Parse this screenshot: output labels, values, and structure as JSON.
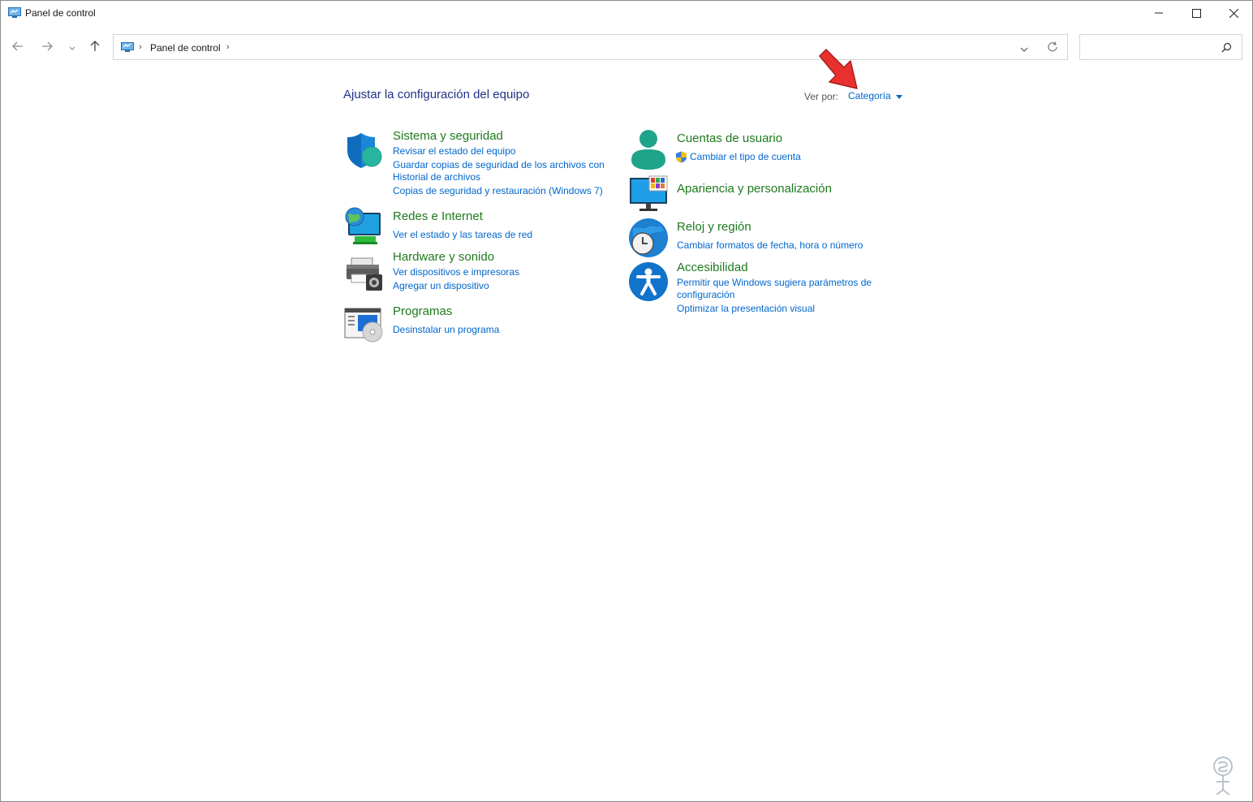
{
  "window": {
    "title": "Panel de control",
    "controls": [
      "minimize-icon",
      "maximize-icon",
      "close-icon"
    ]
  },
  "nav": {
    "back": "back-arrow-icon",
    "forward": "forward-arrow-icon",
    "recent": "chevron-down-icon",
    "up": "up-arrow-icon"
  },
  "address": {
    "separator": "›",
    "crumb": "Panel de control"
  },
  "search": {
    "placeholder": ""
  },
  "content": {
    "title": "Ajustar la configuración del equipo",
    "view_by_label": "Ver por:",
    "view_by_value": "Categoría"
  },
  "categories": {
    "left": [
      {
        "title": "Sistema y seguridad",
        "icon": "shield-icon",
        "links": [
          "Revisar el estado del equipo",
          "Guardar copias de seguridad de los archivos con",
          "Historial de archivos",
          "Copias de seguridad y restauración (Windows 7)"
        ]
      },
      {
        "title": "Redes e Internet",
        "icon": "network-globe-icon",
        "links": [
          "Ver el estado y las tareas de red"
        ]
      },
      {
        "title": "Hardware y sonido",
        "icon": "printer-icon",
        "links": [
          "Ver dispositivos e impresoras",
          "Agregar un dispositivo"
        ]
      },
      {
        "title": "Programas",
        "icon": "programs-icon",
        "links": [
          "Desinstalar un programa"
        ]
      }
    ],
    "right": [
      {
        "title": "Cuentas de usuario",
        "icon": "user-icon",
        "links": [
          "Cambiar el tipo de cuenta"
        ]
      },
      {
        "title": "Apariencia y personalización",
        "icon": "monitor-icon",
        "links": []
      },
      {
        "title": "Reloj y región",
        "icon": "clock-globe-icon",
        "links": [
          "Cambiar formatos de fecha, hora o número"
        ]
      },
      {
        "title": "Accesibilidad",
        "icon": "accessibility-icon",
        "links": [
          "Permitir que Windows sugiera parámetros de",
          "configuración",
          "Optimizar la presentación visual"
        ]
      }
    ]
  },
  "colors": {
    "title_blue": "#1e3287",
    "link_blue": "#0066cc",
    "category_green": "#1e7a1e",
    "annotation_red": "#e8312f"
  }
}
